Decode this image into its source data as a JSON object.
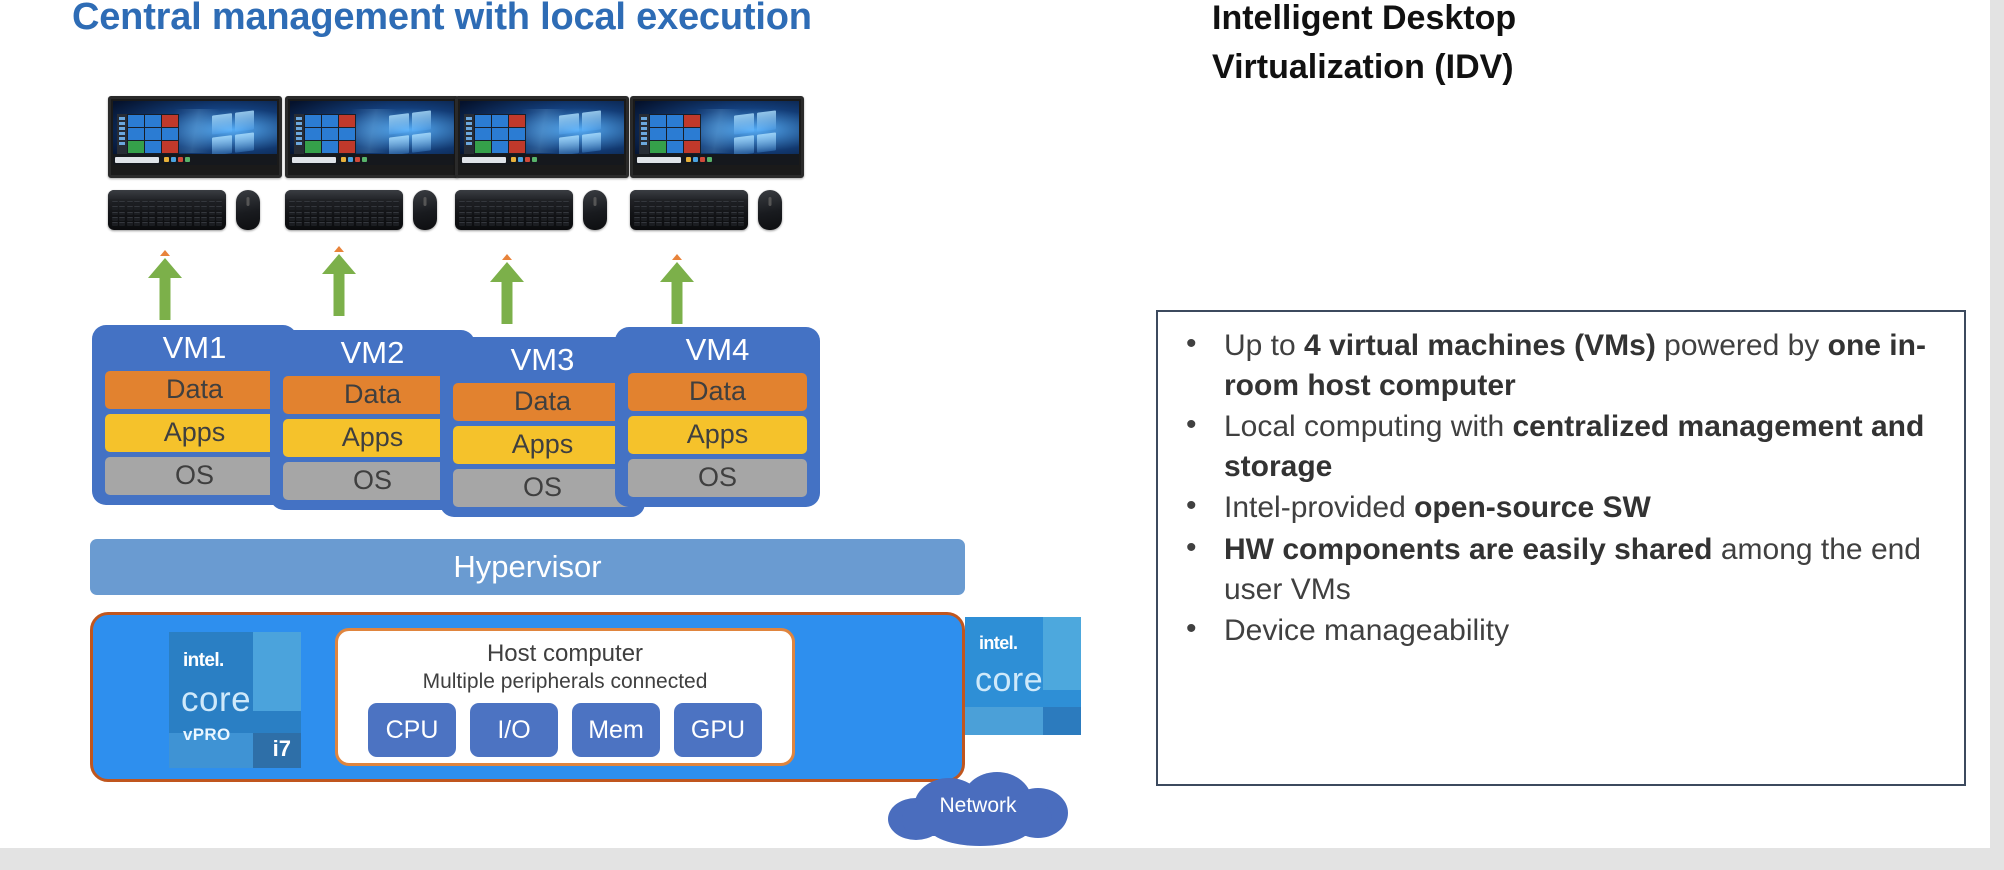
{
  "slide": {
    "left_title": "Central management with local execution",
    "right_title": "Intelligent Desktop Virtualization (IDV)"
  },
  "colors": {
    "title_blue": "#2E6CB5",
    "vm_blue": "#4472C4",
    "data_orange": "#E2822F",
    "apps_yellow": "#F5C22B",
    "os_gray": "#A6A6A6",
    "hypervisor_blue": "#6A9BD1",
    "host_blue": "#2E8FEE",
    "host_border_orange": "#C0561E",
    "arrow_green": "#7CB04A",
    "cloud_blue": "#4A6DBE",
    "box_border": "#3C4A5E",
    "intel_badge_blue": "#2A7FC4"
  },
  "stations": [
    {
      "id": "station-1",
      "monitor": "windows-desktop-monitor",
      "keyboard": "keyboard-icon",
      "mouse": "mouse-icon"
    },
    {
      "id": "station-2",
      "monitor": "windows-desktop-monitor",
      "keyboard": "keyboard-icon",
      "mouse": "mouse-icon"
    },
    {
      "id": "station-3",
      "monitor": "windows-desktop-monitor",
      "keyboard": "keyboard-icon",
      "mouse": "mouse-icon"
    },
    {
      "id": "station-4",
      "monitor": "windows-desktop-monitor",
      "keyboard": "keyboard-icon",
      "mouse": "mouse-icon"
    }
  ],
  "vms": [
    {
      "title": "VM1",
      "layers": [
        {
          "label": "Data"
        },
        {
          "label": "Apps"
        },
        {
          "label": "OS"
        }
      ]
    },
    {
      "title": "VM2",
      "layers": [
        {
          "label": "Data"
        },
        {
          "label": "Apps"
        },
        {
          "label": "OS"
        }
      ]
    },
    {
      "title": "VM3",
      "layers": [
        {
          "label": "Data"
        },
        {
          "label": "Apps"
        },
        {
          "label": "OS"
        }
      ]
    },
    {
      "title": "VM4",
      "layers": [
        {
          "label": "Data"
        },
        {
          "label": "Apps"
        },
        {
          "label": "OS"
        }
      ]
    }
  ],
  "hypervisor": {
    "label": "Hypervisor"
  },
  "host": {
    "cpu_badge": {
      "brand": "intel.",
      "family": "core",
      "tier": "vPRO",
      "sku": "i7"
    },
    "title": "Host computer",
    "subtitle": "Multiple peripherals connected",
    "chips": [
      {
        "label": "CPU"
      },
      {
        "label": "I/O"
      },
      {
        "label": "Mem"
      },
      {
        "label": "GPU"
      }
    ],
    "side_badge": {
      "brand": "intel.",
      "family": "core"
    }
  },
  "network": {
    "label": "Network"
  },
  "bullets": [
    {
      "html": "Up to <b>4 virtual machines (VMs)</b> powered by <b>one in-room host computer</b>",
      "text": "Up to 4 virtual machines (VMs) powered by one in-room host computer"
    },
    {
      "html": "Local computing with <b>centralized management and storage</b>",
      "text": "Local computing with centralized management and storage"
    },
    {
      "html": "Intel-provided <b>open-source SW</b>",
      "text": "Intel-provided open-source SW"
    },
    {
      "html": "<b>HW components are easily shared</b> among the end user VMs",
      "text": "HW components are easily shared among the end user VMs"
    },
    {
      "html": "Device manageability",
      "text": "Device manageability"
    }
  ]
}
